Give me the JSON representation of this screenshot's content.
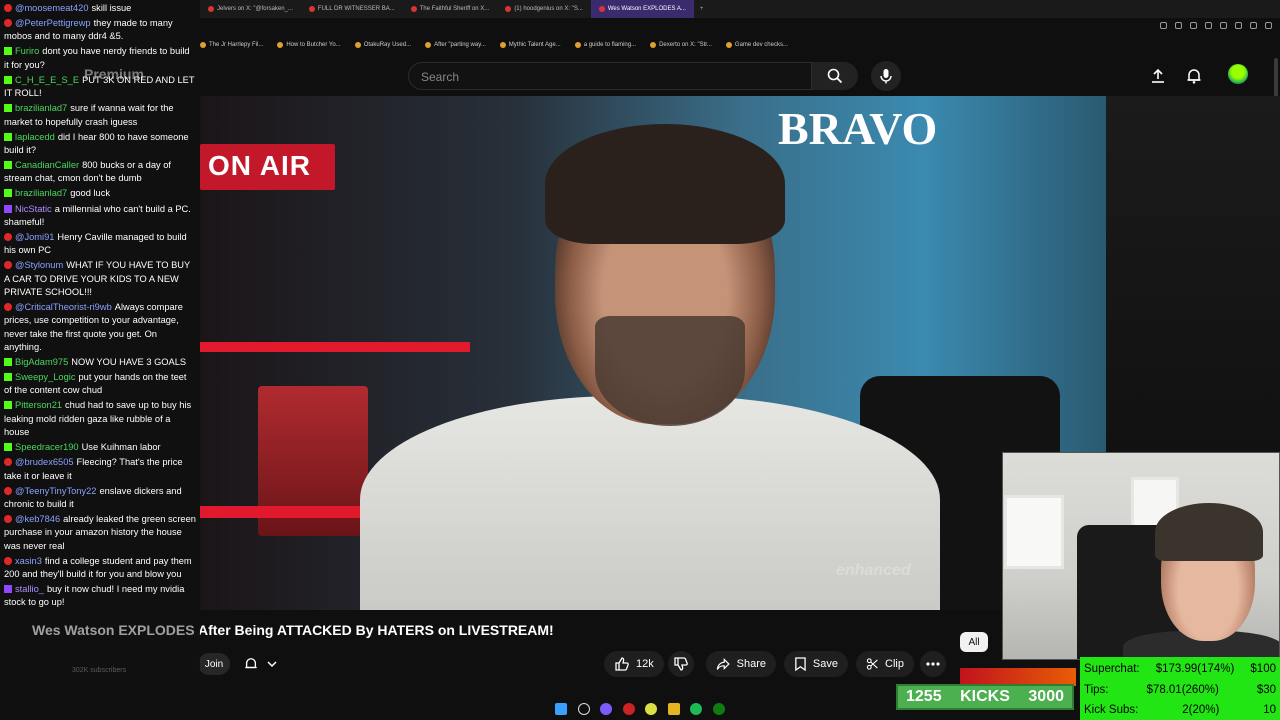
{
  "browser": {
    "tabs": [
      {
        "label": "Jelvers on X: \"@forsaken_..."
      },
      {
        "label": "FULL DR WITNESSER BA..."
      },
      {
        "label": "The Faithful Sheriff on X..."
      },
      {
        "label": "(1) hoodgenius on X: \"S..."
      },
      {
        "label": "Wes Watson EXPLODES A..."
      }
    ],
    "bookmarks": [
      {
        "label": "The Jr Harrlepy Fil..."
      },
      {
        "label": "How to Butcher Yo..."
      },
      {
        "label": "OtakuRay Used..."
      },
      {
        "label": "After \"parting way..."
      },
      {
        "label": "Mythic Talent Age..."
      },
      {
        "label": "a guide to flaming..."
      },
      {
        "label": "Dexerto on X: \"Str..."
      },
      {
        "label": "Game dev checks..."
      }
    ]
  },
  "youtube": {
    "logo_label": "Premium",
    "search_placeholder": "Search",
    "video_title": "After Being ATTACKED By HATERS on LIVESTREAM!",
    "channel_overlay": "Wes Watson EXPLODES",
    "subscribers": "302K subscribers",
    "join_label": "Join",
    "like_count": "12k",
    "share_label": "Share",
    "save_label": "Save",
    "clip_label": "Clip",
    "filter_chip": "All",
    "video_scene": {
      "sign_on_air": "ON AIR",
      "sign_brand": "BRAVO",
      "watermark": "enhanced"
    }
  },
  "chat": [
    {
      "platform": "yt",
      "user": "@moosemeat420",
      "text": "skill issue"
    },
    {
      "platform": "yt",
      "user": "@PeterPettigrewp",
      "text": "they made to many mobos and to many ddr4 &5."
    },
    {
      "platform": "kick",
      "user": "Furiro",
      "text": "dont you have nerdy friends to build it for you?"
    },
    {
      "platform": "kick",
      "user": "C_H_E_E_S_E",
      "text": "PUT 3K ON RED AND LET IT ROLL!"
    },
    {
      "platform": "kick",
      "user": "brazilianlad7",
      "text": "sure if wanna wait for the market to hopefully crash iguess"
    },
    {
      "platform": "kick",
      "user": "laplacedd",
      "text": "did I hear 800 to have someone build it?"
    },
    {
      "platform": "kick",
      "user": "CanadianCaller",
      "text": "800 bucks or a day of stream chat, cmon don't be dumb"
    },
    {
      "platform": "kick",
      "user": "brazilianlad7",
      "text": "good luck"
    },
    {
      "platform": "twitch",
      "user": "NicStatic",
      "text": "a millennial who can't build a PC. shameful!"
    },
    {
      "platform": "yt",
      "user": "@Jomi91",
      "text": "Henry Caville managed to build his own PC"
    },
    {
      "platform": "yt",
      "user": "@Stylonum",
      "text": "WHAT IF YOU HAVE TO BUY A CAR TO DRIVE YOUR KIDS TO A NEW PRIVATE SCHOOL!!!"
    },
    {
      "platform": "yt",
      "user": "@CriticalTheorist-ri9wb",
      "text": "Always compare prices, use competition to your advantage, never take the first quote you get. On anything."
    },
    {
      "platform": "kick",
      "user": "BigAdam975",
      "text": "NOW YOU HAVE 3 GOALS"
    },
    {
      "platform": "kick",
      "user": "Sweepy_Logic",
      "text": "put your hands on the teet of the content cow chud"
    },
    {
      "platform": "kick",
      "user": "Pitterson21",
      "text": "chud had to save up to buy his leaking mold ridden gaza like rubble of a house"
    },
    {
      "platform": "kick",
      "user": "Speedracer190",
      "text": "Use Kuihman labor"
    },
    {
      "platform": "yt",
      "user": "@brudex6505",
      "text": "Fleecing? That's the price take it or leave it"
    },
    {
      "platform": "yt",
      "user": "@TeenyTinyTony22",
      "text": "enslave dickers and chronic to build it"
    },
    {
      "platform": "yt",
      "user": "@keb7846",
      "text": "already leaked the green screen purchase in your amazon history the house was never real"
    },
    {
      "platform": "yt",
      "user": "xasin3",
      "text": "find a college student and pay them 200 and they'll build it for you and blow you"
    },
    {
      "platform": "twitch",
      "user": "stallio_",
      "text": "buy it now chud! I need my nvidia stock to go up!"
    }
  ],
  "kicks_bar": {
    "current": "1255",
    "label": "KICKS",
    "goal": "3000"
  },
  "goals": [
    {
      "label": "Superchat:",
      "value": "$173.99(174%)",
      "target": "$100"
    },
    {
      "label": "Tips:",
      "value": "$78.01(260%)",
      "target": "$30"
    },
    {
      "label": "Kick Subs:",
      "value": "2(20%)",
      "target": "10"
    }
  ],
  "colors": {
    "yt_badge": "#e02828",
    "kick_badge": "#53fc18",
    "twitch_badge": "#9147ff",
    "goal_panel": "#22e614",
    "kicks_bar": "#4caf50"
  },
  "icons": [
    "search-icon",
    "mic-icon",
    "upload-icon",
    "bell-icon",
    "like-icon",
    "dislike-icon",
    "share-icon",
    "save-icon",
    "clip-icon",
    "more-icon",
    "chevron-down-icon"
  ]
}
